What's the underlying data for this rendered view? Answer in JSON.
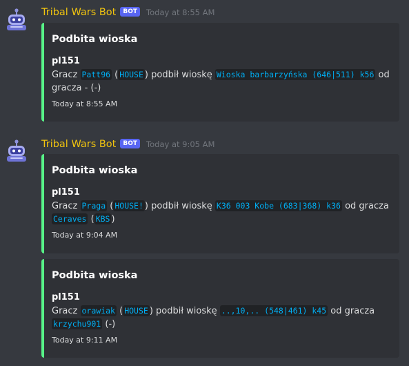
{
  "bot": {
    "name": "Tribal Wars Bot",
    "tag": "BOT",
    "avatar_icon": "robot-icon"
  },
  "colors": {
    "background": "#36393f",
    "embed_bg": "#2f3136",
    "embed_accent": "#57f287",
    "username": "#f1c40f",
    "bot_tag": "#5865f2"
  },
  "messages": [
    {
      "timestamp": "Today at 8:55 AM",
      "embeds": [
        {
          "title": "Podbita wioska",
          "world": "pl151",
          "word_player": "Gracz",
          "player": "Patt96",
          "tribe": "HOUSE",
          "verb": "podbił wioskę",
          "village": "Wioska barbarzyńska (646|511) k56",
          "from": "od gracza",
          "prev_owner": "-",
          "prev_tribe": "(-)",
          "footer": "Today at 8:55 AM"
        }
      ]
    },
    {
      "timestamp": "Today at 9:05 AM",
      "embeds": [
        {
          "title": "Podbita wioska",
          "world": "pl151",
          "word_player": "Gracz",
          "player": "Praga",
          "tribe": "HOUSE!",
          "verb": "podbił wioskę",
          "village": "K36 003 Kobe (683|368) k36",
          "from": "od gracza",
          "prev_owner": "Ceraves",
          "prev_tribe": "KBS",
          "footer": "Today at 9:04 AM"
        },
        {
          "title": "Podbita wioska",
          "world": "pl151",
          "word_player": "Gracz",
          "player": "orawiak",
          "tribe": "HOUSE",
          "verb": "podbił wioskę",
          "village": "..,10,.. (548|461) k45",
          "from": "od gracza",
          "prev_owner": "krzychu901",
          "prev_tribe": "(-)",
          "footer": "Today at 9:11 AM"
        }
      ]
    }
  ]
}
